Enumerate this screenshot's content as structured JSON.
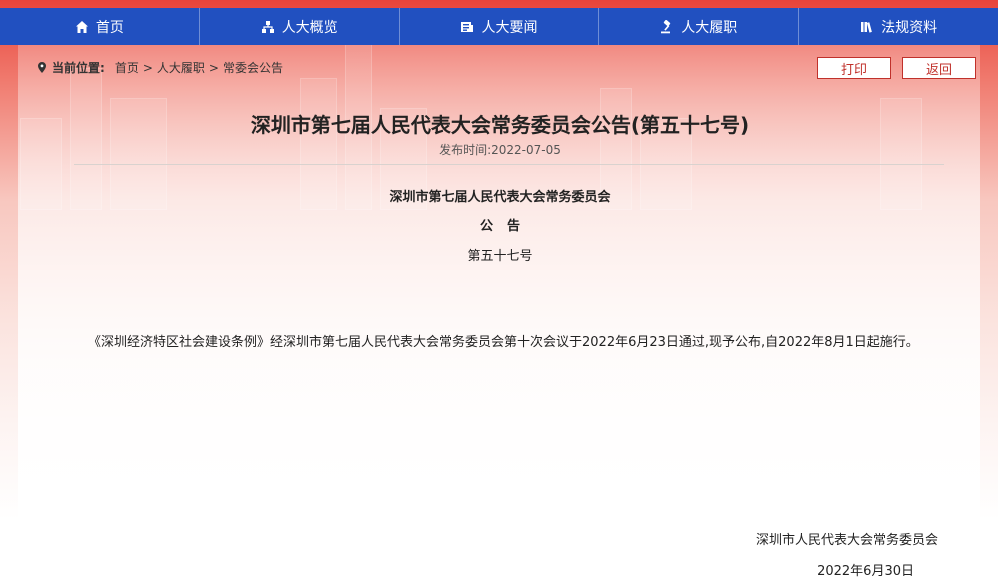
{
  "nav": {
    "items": [
      {
        "label": "首页",
        "icon": "home-icon"
      },
      {
        "label": "人大概览",
        "icon": "org-chart-icon"
      },
      {
        "label": "人大要闻",
        "icon": "news-icon"
      },
      {
        "label": "人大履职",
        "icon": "gavel-icon"
      },
      {
        "label": "法规资料",
        "icon": "books-icon"
      }
    ]
  },
  "breadcrumb": {
    "label": "当前位置:",
    "items": [
      "首页",
      "人大履职",
      "常委会公告"
    ],
    "separator": ">"
  },
  "actions": {
    "print": "打印",
    "back": "返回"
  },
  "article": {
    "title": "深圳市第七届人民代表大会常务委员会公告(第五十七号)",
    "date": "发布时间:2022-07-05",
    "org": "深圳市第七届人民代表大会常务委员会",
    "gonggao": "公告",
    "number": "第五十七号",
    "body": "《深圳经济特区社会建设条例》经深圳市第七届人民代表大会常务委员会第十次会议于2022年6月23日通过,现予公布,自2022年8月1日起施行。",
    "signer": "深圳市人民代表大会常务委员会",
    "sign_date": "2022年6月30日"
  },
  "colors": {
    "nav_bg": "#2150c0",
    "accent_red": "#c0312b",
    "header_red": "#e8443a"
  }
}
